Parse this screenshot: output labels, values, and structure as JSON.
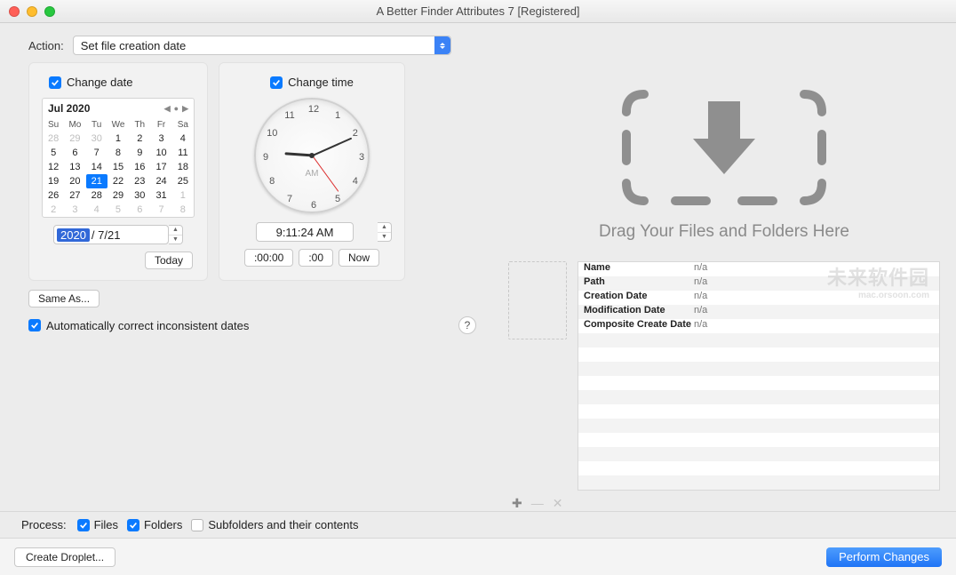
{
  "window": {
    "title": "A Better Finder Attributes 7 [Registered]"
  },
  "action": {
    "label": "Action:",
    "value": "Set file creation date"
  },
  "change_date": {
    "checkbox_label": "Change date",
    "month_year": "Jul 2020",
    "dow": [
      "Su",
      "Mo",
      "Tu",
      "We",
      "Th",
      "Fr",
      "Sa"
    ],
    "prev_tail": [
      28,
      29,
      30
    ],
    "days": [
      1,
      2,
      3,
      4,
      5,
      6,
      7,
      8,
      9,
      10,
      11,
      12,
      13,
      14,
      15,
      16,
      17,
      18,
      19,
      20,
      21,
      22,
      23,
      24,
      25,
      26,
      27,
      28,
      29,
      30,
      31
    ],
    "next_head": [
      1,
      2,
      3,
      4,
      5,
      6,
      7,
      8
    ],
    "selected": 21,
    "year_field": "2020",
    "date_field": "/  7/21",
    "today_btn": "Today"
  },
  "change_time": {
    "checkbox_label": "Change time",
    "ampm": "AM",
    "time_field": "9:11:24 AM",
    "btn_zero": ":00:00",
    "btn_min": ":00",
    "btn_now": "Now",
    "hour_angle": 274,
    "min_angle": 66,
    "sec_angle": 144
  },
  "same_as_btn": "Same As...",
  "auto_correct": {
    "label": "Automatically correct inconsistent dates"
  },
  "dropzone_caption": "Drag Your Files and Folders Here",
  "properties": [
    {
      "k": "Name",
      "v": "n/a"
    },
    {
      "k": "Path",
      "v": "n/a"
    },
    {
      "k": "Creation Date",
      "v": "n/a"
    },
    {
      "k": "Modification Date",
      "v": "n/a"
    },
    {
      "k": "Composite Create Date",
      "v": "n/a"
    }
  ],
  "process": {
    "label": "Process:",
    "files": "Files",
    "folders": "Folders",
    "subfolders": "Subfolders and their contents"
  },
  "bottom": {
    "create_droplet": "Create Droplet...",
    "perform": "Perform Changes"
  },
  "watermark": {
    "main": "未来软件园",
    "sub": "mac.orsoon.com"
  }
}
